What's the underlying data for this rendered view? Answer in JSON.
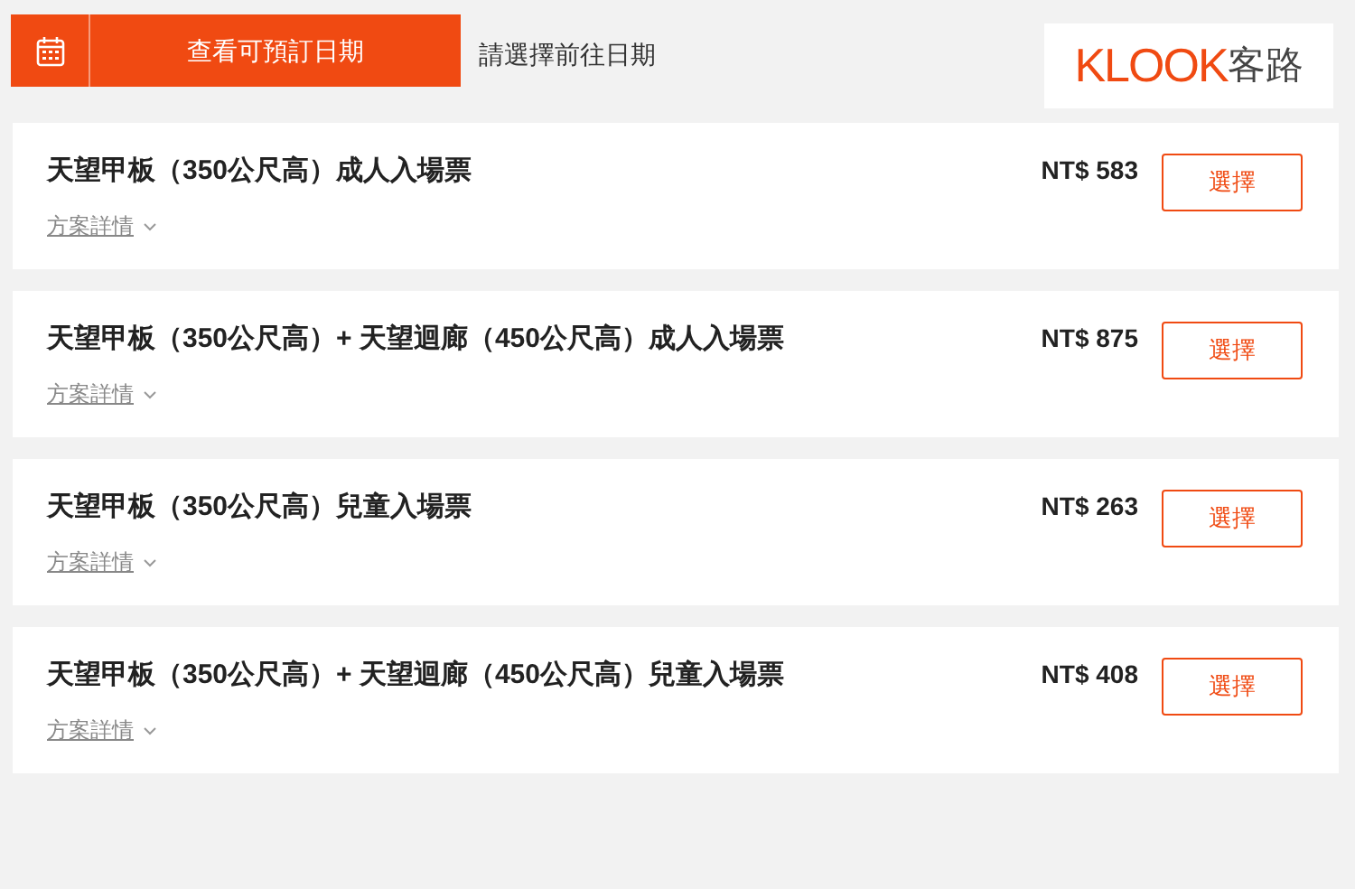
{
  "header": {
    "date_button": "查看可預訂日期",
    "hint": "請選擇前往日期",
    "logo": {
      "brand": "KLOOK",
      "brand_cn": "客路"
    }
  },
  "packages": [
    {
      "title": "天望甲板（350公尺高）成人入場票",
      "details": "方案詳情",
      "price": "NT$ 583",
      "button": "選擇"
    },
    {
      "title": "天望甲板（350公尺高）+ 天望迴廊（450公尺高）成人入場票",
      "details": "方案詳情",
      "price": "NT$ 875",
      "button": "選擇"
    },
    {
      "title": "天望甲板（350公尺高）兒童入場票",
      "details": "方案詳情",
      "price": "NT$ 263",
      "button": "選擇"
    },
    {
      "title": "天望甲板（350公尺高）+ 天望迴廊（450公尺高）兒童入場票",
      "details": "方案詳情",
      "price": "NT$ 408",
      "button": "選擇"
    }
  ]
}
